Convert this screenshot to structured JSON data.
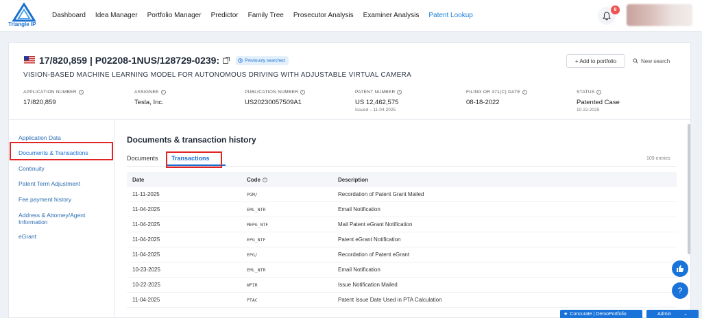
{
  "brand": {
    "logo_text": "Triangle IP",
    "accent": "#1a6fd1"
  },
  "nav": {
    "items": [
      "Dashboard",
      "Idea Manager",
      "Portfolio Manager",
      "Predictor",
      "Family Tree",
      "Prosecutor Analysis",
      "Examiner Analysis",
      "Patent Lookup"
    ],
    "active": "Patent Lookup"
  },
  "notifications": {
    "count": "8"
  },
  "header": {
    "title": "17/820,859 | P02208-1NUS/128729-0239:",
    "previously_searched": "Previously searched",
    "add_to_portfolio": "+ Add to portfolio",
    "new_search": "New search",
    "document_title": "VISION-BASED MACHINE LEARNING MODEL FOR AUTONOMOUS DRIVING WITH ADJUSTABLE VIRTUAL CAMERA"
  },
  "meta": [
    {
      "label": "APPLICATION NUMBER",
      "value": "17/820,859",
      "sub": ""
    },
    {
      "label": "ASSIGNEE",
      "value": "Tesla, Inc.",
      "sub": ""
    },
    {
      "label": "PUBLICATION NUMBER",
      "value": "US20230057509A1",
      "sub": ""
    },
    {
      "label": "PATENT NUMBER",
      "value": "US 12,462,575",
      "sub": "Issued – 11-04-2025"
    },
    {
      "label": "FILING OR 371(C) DATE",
      "value": "08-18-2022",
      "sub": ""
    },
    {
      "label": "STATUS",
      "value": "Patented Case",
      "sub": "10-22-2025"
    }
  ],
  "sidebar": {
    "items": [
      "Application Data",
      "Documents & Transactions",
      "Continuity",
      "Patent Term Adjustment",
      "Fee payment history",
      "Address & Attorney/Agent",
      "Information",
      "eGrant"
    ],
    "active": "Documents & Transactions"
  },
  "content": {
    "title": "Documents & transaction history",
    "tabs": [
      "Documents",
      "Transactions"
    ],
    "active_tab": "Transactions",
    "entries": "109 entries"
  },
  "table": {
    "headers": [
      "Date",
      "Code",
      "Description"
    ],
    "rows": [
      [
        "11-11-2025",
        "PGM/",
        "Recordation of Patent Grant Mailed"
      ],
      [
        "11-04-2025",
        "EML_NTR",
        "Email Notification"
      ],
      [
        "11-04-2025",
        "MEPG_NTF",
        "Mail Patent eGrant Notification"
      ],
      [
        "11-04-2025",
        "EPG_NTF",
        "Patent eGrant Notification"
      ],
      [
        "11-04-2025",
        "EPG/",
        "Recordation of Patent eGrant"
      ],
      [
        "10-23-2025",
        "EML_NTR",
        "Email Notification"
      ],
      [
        "10-22-2025",
        "WPIR",
        "Issue Notification Mailed"
      ],
      [
        "11-04-2025",
        "PTAC",
        "Patent Issue Date Used in PTA Calculation"
      ]
    ]
  },
  "footer": {
    "concurate": "Concurate | DemoPortfolio",
    "admin": "Admin"
  }
}
